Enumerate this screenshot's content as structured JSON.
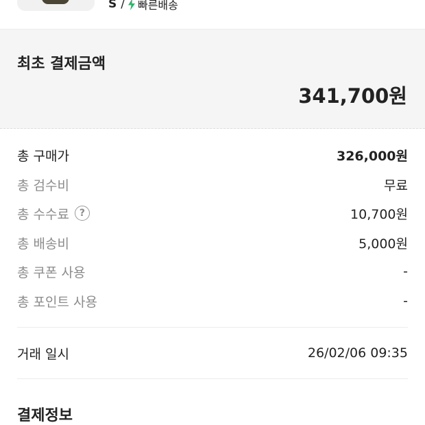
{
  "product": {
    "size": "S",
    "separator": "/",
    "delivery_icon": "lightning-icon",
    "delivery_label": "빠른배송",
    "delivery_color": "#31b46e"
  },
  "total": {
    "label": "최초 결제금액",
    "value": "341,700원"
  },
  "breakdown": [
    {
      "label": "총 구매가",
      "value": "326,000원"
    },
    {
      "label": "총 검수비",
      "value": "무료"
    },
    {
      "label": "총 수수료",
      "value": "10,700원",
      "help_icon": "question-circle-icon"
    },
    {
      "label": "총 배송비",
      "value": "5,000원"
    },
    {
      "label": "총 쿠폰 사용",
      "value": "-"
    },
    {
      "label": "총 포인트 사용",
      "value": "-"
    }
  ],
  "transaction": {
    "label": "거래 일시",
    "value": "26/02/06 09:35"
  },
  "payment_section": {
    "title": "결제정보"
  }
}
